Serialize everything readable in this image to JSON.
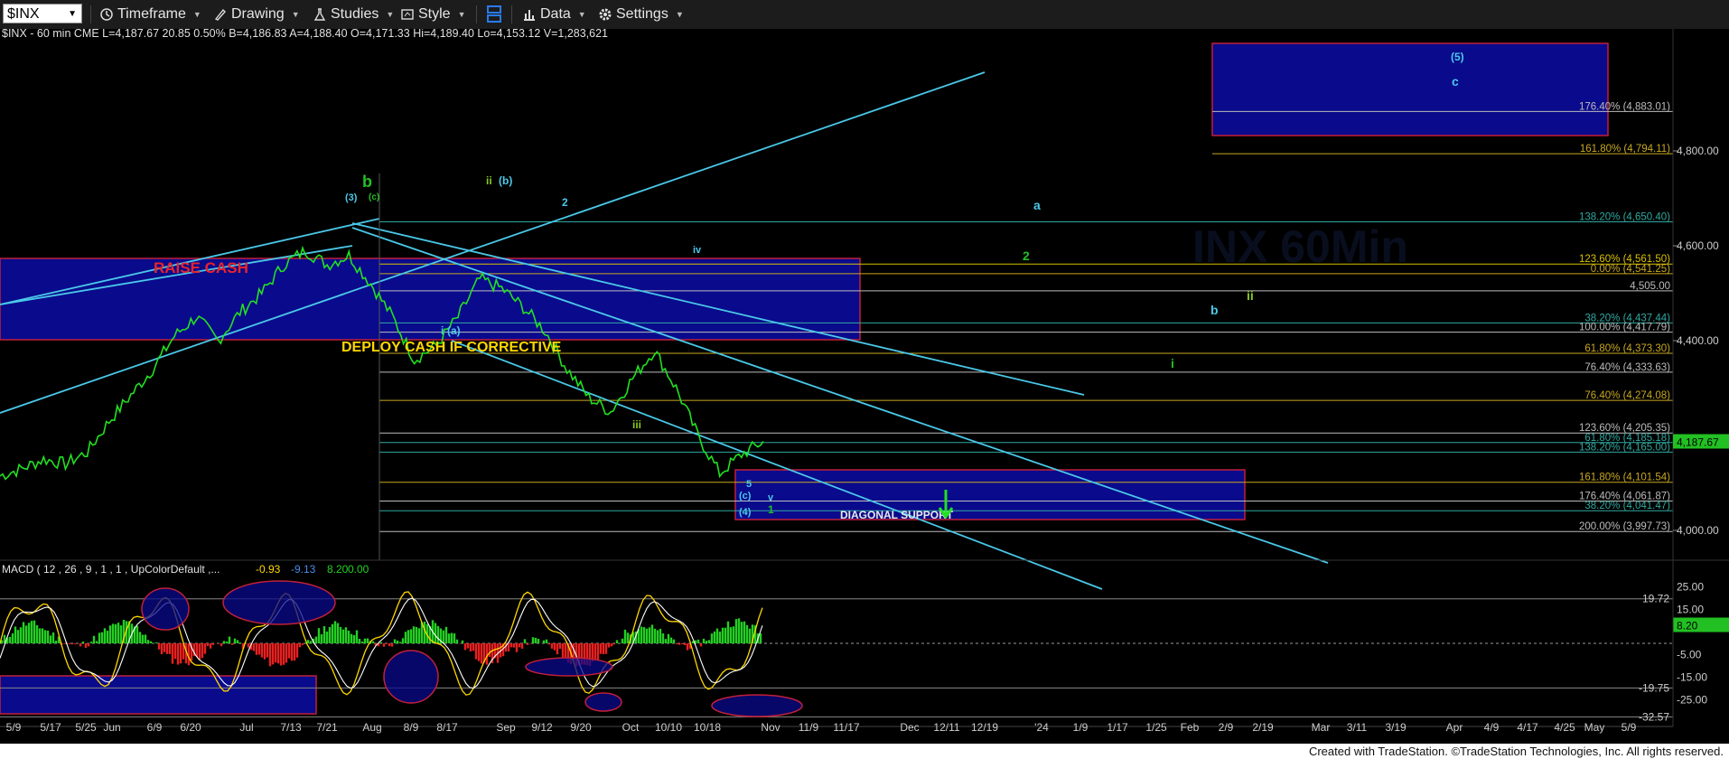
{
  "toolbar": {
    "symbol": "$INX",
    "items": [
      {
        "label": "Timeframe",
        "icon": "timeframe-icon"
      },
      {
        "label": "Drawing",
        "icon": "pencil-icon"
      },
      {
        "label": "Studies",
        "icon": "flask-icon"
      },
      {
        "label": "Style",
        "icon": "style-icon"
      },
      {
        "label": "",
        "icon": "layout-icon"
      },
      {
        "label": "Data",
        "icon": "data-bars-icon"
      },
      {
        "label": "Settings",
        "icon": "gear-icon"
      }
    ]
  },
  "chart_data": {
    "type": "line",
    "header": "$INX - 60 min  CME  L=4,187.67  20.85  0.50%  B=4,186.83  A=4,188.40  O=4,171.33  Hi=4,189.40  Lo=4,153.12  V=1,283,621",
    "last_price": "4,187.67",
    "y_axis": {
      "ticks": [
        "4,800.00",
        "4,600.00",
        "4,400.00",
        "4,000.00"
      ],
      "range": [
        3920,
        4980
      ]
    },
    "x_axis": {
      "ticks": [
        "5/9",
        "5/17",
        "5/25",
        "Jun",
        "6/9",
        "6/20",
        "Jul",
        "7/13",
        "7/21",
        "Aug",
        "8/9",
        "8/17",
        "Sep",
        "9/12",
        "9/20",
        "Oct",
        "10/10",
        "10/18",
        "Nov",
        "11/9",
        "11/17",
        "Dec",
        "12/11",
        "12/19",
        "'24",
        "1/9",
        "1/17",
        "1/25",
        "Feb",
        "2/9",
        "2/19",
        "Mar",
        "3/11",
        "3/19",
        "Apr",
        "4/9",
        "4/17",
        "4/25",
        "May",
        "5/9"
      ]
    },
    "series": [
      {
        "values": [
          4115,
          4130,
          4150,
          4140,
          4165,
          4230,
          4285,
          4340,
          4410,
          4450,
          4400,
          4460,
          4500,
          4560,
          4590,
          4560,
          4580,
          4520,
          4450,
          4360,
          4390,
          4450,
          4530,
          4510,
          4470,
          4420,
          4340,
          4280,
          4250,
          4320,
          4380,
          4300,
          4200,
          4120,
          4160,
          4187.67
        ]
      }
    ],
    "levels": [
      {
        "label": "176.40% (4,883.01)",
        "value": 4883.01,
        "color": "#bcbcbc"
      },
      {
        "label": "161.80% (4,794.11)",
        "value": 4794.11,
        "color": "#c8a820"
      },
      {
        "label": "138.20% (4,650.40)",
        "value": 4650.4,
        "color": "#2fa8a0"
      },
      {
        "label": "123.60% (4,561.50)",
        "value": 4561.5,
        "color": "#d8c000"
      },
      {
        "label": "0.00% (4,541.25)",
        "value": 4541.25,
        "color": "#c8a820"
      },
      {
        "label": "4,505.00",
        "value": 4505.0,
        "color": "#bcbcbc"
      },
      {
        "label": "38.20% (4,437.44)",
        "value": 4437.44,
        "color": "#2fa8a0"
      },
      {
        "label": "100.00% (4,417.79)",
        "value": 4417.79,
        "color": "#bcbcbc"
      },
      {
        "label": "61.80% (4,373.30)",
        "value": 4373.3,
        "color": "#c8a820"
      },
      {
        "label": "76.40% (4,333.63)",
        "value": 4333.63,
        "color": "#bcbcbc"
      },
      {
        "label": "76.40% (4,274.08)",
        "value": 4274.08,
        "color": "#c8a820"
      },
      {
        "label": "123.60% (4,205.35)",
        "value": 4205.35,
        "color": "#bcbcbc"
      },
      {
        "label": "61.80% (4,185.18)",
        "value": 4185.18,
        "color": "#2fa8a0"
      },
      {
        "label": "138.20% (4,165.00)",
        "value": 4165.0,
        "color": "#2fa8a0"
      },
      {
        "label": "161.80% (4,101.54)",
        "value": 4101.54,
        "color": "#c8a820"
      },
      {
        "label": "176.40% (4,061.87)",
        "value": 4061.87,
        "color": "#bcbcbc"
      },
      {
        "label": "38.20% (4,041.47)",
        "value": 4041.47,
        "color": "#2fa8a0"
      },
      {
        "label": "200.00% (3,997.73)",
        "value": 3997.73,
        "color": "#bcbcbc"
      }
    ],
    "annotations": [
      {
        "text": "RAISE CASH",
        "color": "#e8242a"
      },
      {
        "text": "DEPLOY CASH IF CORRECTIVE",
        "color": "#ffd700"
      },
      {
        "text": "DIAGONAL SUPPORT",
        "color": "#e8e8e8"
      }
    ],
    "wave_labels": [
      {
        "text": "b",
        "color": "#22c022"
      },
      {
        "text": "(3)",
        "color": "#4ac8e8"
      },
      {
        "text": "(c)",
        "color": "#22c022"
      },
      {
        "text": "ii",
        "color": "#8ac820"
      },
      {
        "text": "(b)",
        "color": "#4ac8e8"
      },
      {
        "text": "2",
        "color": "#4ac8e8"
      },
      {
        "text": "a",
        "color": "#4ac8e8"
      },
      {
        "text": "2",
        "color": "#22c022"
      },
      {
        "text": "ii",
        "color": "#8ac820"
      },
      {
        "text": "b",
        "color": "#4ac8e8"
      },
      {
        "text": "i",
        "color": "#22c022"
      },
      {
        "text": "(5)",
        "color": "#4ac8e8"
      },
      {
        "text": "c",
        "color": "#4ac8e8"
      },
      {
        "text": "i",
        "color": "#4ac8e8"
      },
      {
        "text": "(a)",
        "color": "#4ac8e8"
      },
      {
        "text": "iii",
        "color": "#8ac820"
      },
      {
        "text": "iv",
        "color": "#4ac8e8"
      },
      {
        "text": "(c)",
        "color": "#4ac8e8"
      },
      {
        "text": "(4)",
        "color": "#4ac8e8"
      },
      {
        "text": "1",
        "color": "#22c022"
      },
      {
        "text": "v",
        "color": "#4ac8e8"
      },
      {
        "text": "5",
        "color": "#4ac8e8"
      }
    ],
    "macd": {
      "header": "MACD ( 12 , 26 , 9 , 1 , 1 , UpColorDefault ,...",
      "values": [
        "-0.93",
        "-9.13",
        "8.20",
        "0.00"
      ],
      "value_colors": [
        "#ffd700",
        "#4a8ae8",
        "#22d022",
        "#22d022"
      ],
      "y_ticks": [
        "25.00",
        "15.00",
        "-5.00",
        "-15.00",
        "-25.00"
      ],
      "levels": [
        "19.72",
        "-19.75",
        "-32.57"
      ],
      "last_value": "8.20"
    }
  },
  "footer": "Created with TradeStation. ©TradeStation Technologies, Inc. All rights reserved."
}
